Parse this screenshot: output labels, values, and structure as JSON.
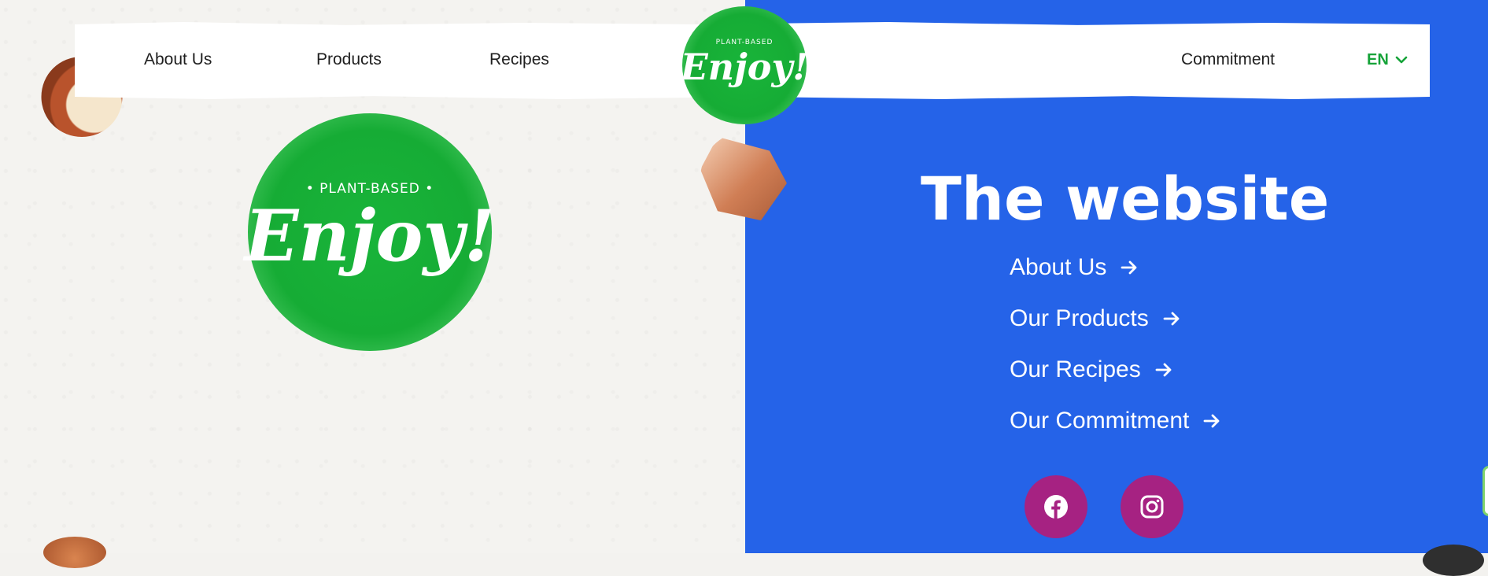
{
  "header": {
    "nav": {
      "about": "About Us",
      "products": "Products",
      "recipes": "Recipes",
      "commitment": "Commitment"
    },
    "language": {
      "selected": "EN",
      "icon": "chevron-down-icon"
    },
    "logo": {
      "tagline": "PLANT-BASED",
      "wordmark": "Enjoy!"
    }
  },
  "hero_logo": {
    "tagline": "• PLANT-BASED •",
    "wordmark": "Enjoy!"
  },
  "sitemap": {
    "title": "The website",
    "links": [
      {
        "label": "About Us",
        "icon": "arrow-right-icon"
      },
      {
        "label": "Our Products",
        "icon": "arrow-right-icon"
      },
      {
        "label": "Our Recipes",
        "icon": "arrow-right-icon"
      },
      {
        "label": "Our Commitment",
        "icon": "arrow-right-icon"
      }
    ],
    "social": [
      {
        "icon": "facebook-icon"
      },
      {
        "icon": "instagram-icon"
      }
    ]
  },
  "colors": {
    "brand_green": "#16ac35",
    "panel_blue": "#2563e8",
    "social_magenta": "#a62282",
    "lang_green": "#16a339"
  }
}
